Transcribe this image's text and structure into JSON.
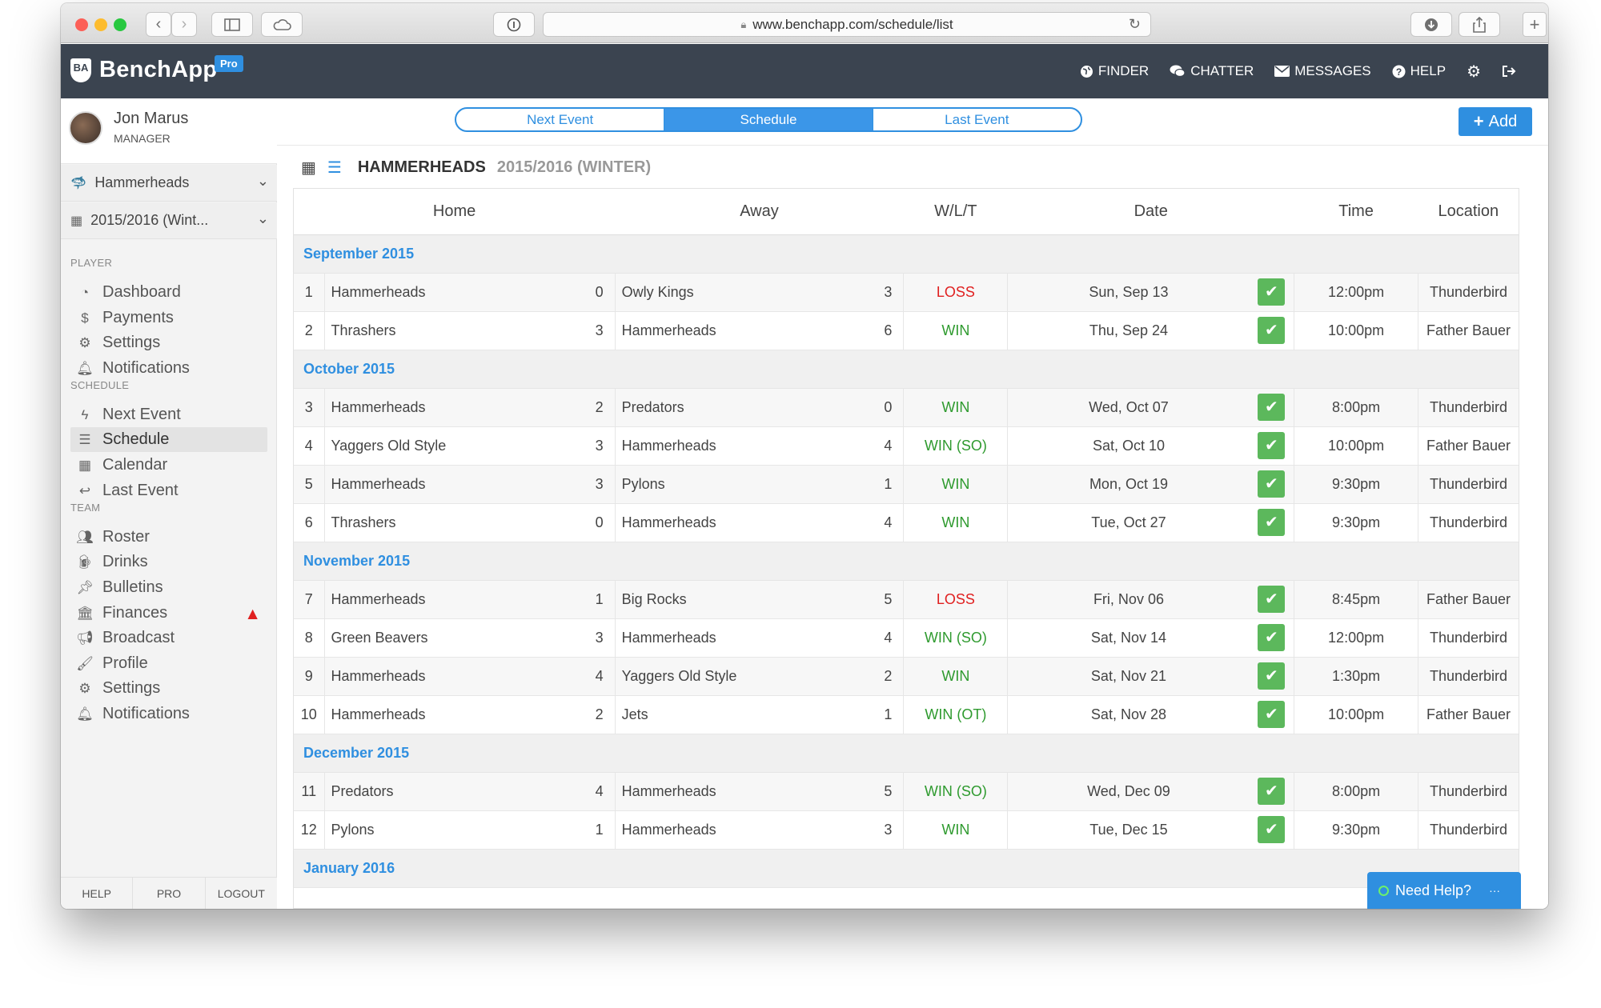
{
  "browser": {
    "url": "www.benchapp.com/schedule/list"
  },
  "app": {
    "name": "BenchApp",
    "logo_badge": "BA",
    "tier_badge": "Pro",
    "colors": {
      "accent": "#2f8fe0",
      "header": "#3b4450",
      "win": "#2e9a2e",
      "loss": "#e02020",
      "check": "#5cb85c"
    }
  },
  "topnav": {
    "finder": "FINDER",
    "chatter": "CHATTER",
    "messages": "MESSAGES",
    "help": "HELP"
  },
  "user": {
    "name": "Jon Marus",
    "role": "MANAGER"
  },
  "sidebar": {
    "team_selector": "Hammerheads",
    "season_selector": "2015/2016 (Wint...",
    "player_label": "PLAYER",
    "player_items": [
      "Dashboard",
      "Payments",
      "Settings",
      "Notifications"
    ],
    "schedule_label": "SCHEDULE",
    "schedule_items": [
      "Next Event",
      "Schedule",
      "Calendar",
      "Last Event"
    ],
    "team_label": "TEAM",
    "team_items": [
      "Roster",
      "Drinks",
      "Bulletins",
      "Finances",
      "Broadcast",
      "Profile",
      "Settings",
      "Notifications"
    ],
    "footer": [
      "HELP",
      "PRO",
      "LOGOUT"
    ]
  },
  "main": {
    "tabs": [
      "Next Event",
      "Schedule",
      "Last Event"
    ],
    "add_label": "Add",
    "title": "HAMMERHEADS",
    "subtitle": "2015/2016 (WINTER)",
    "columns": [
      "Home",
      "Away",
      "W/L/T",
      "Date",
      "Time",
      "Location"
    ],
    "months": [
      {
        "label": "September 2015",
        "games": [
          {
            "n": "1",
            "home": "Hammerheads",
            "hs": "0",
            "away": "Owly Kings",
            "as": "3",
            "res": "LOSS",
            "date": "Sun, Sep 13",
            "time": "12:00pm",
            "loc": "Thunderbird"
          },
          {
            "n": "2",
            "home": "Thrashers",
            "hs": "3",
            "away": "Hammerheads",
            "as": "6",
            "res": "WIN",
            "date": "Thu, Sep 24",
            "time": "10:00pm",
            "loc": "Father Bauer"
          }
        ]
      },
      {
        "label": "October 2015",
        "games": [
          {
            "n": "3",
            "home": "Hammerheads",
            "hs": "2",
            "away": "Predators",
            "as": "0",
            "res": "WIN",
            "date": "Wed, Oct 07",
            "time": "8:00pm",
            "loc": "Thunderbird"
          },
          {
            "n": "4",
            "home": "Yaggers Old Style",
            "hs": "3",
            "away": "Hammerheads",
            "as": "4",
            "res": "WIN (SO)",
            "date": "Sat, Oct 10",
            "time": "10:00pm",
            "loc": "Father Bauer"
          },
          {
            "n": "5",
            "home": "Hammerheads",
            "hs": "3",
            "away": "Pylons",
            "as": "1",
            "res": "WIN",
            "date": "Mon, Oct 19",
            "time": "9:30pm",
            "loc": "Thunderbird"
          },
          {
            "n": "6",
            "home": "Thrashers",
            "hs": "0",
            "away": "Hammerheads",
            "as": "4",
            "res": "WIN",
            "date": "Tue, Oct 27",
            "time": "9:30pm",
            "loc": "Thunderbird"
          }
        ]
      },
      {
        "label": "November 2015",
        "games": [
          {
            "n": "7",
            "home": "Hammerheads",
            "hs": "1",
            "away": "Big Rocks",
            "as": "5",
            "res": "LOSS",
            "date": "Fri, Nov 06",
            "time": "8:45pm",
            "loc": "Father Bauer"
          },
          {
            "n": "8",
            "home": "Green Beavers",
            "hs": "3",
            "away": "Hammerheads",
            "as": "4",
            "res": "WIN (SO)",
            "date": "Sat, Nov 14",
            "time": "12:00pm",
            "loc": "Thunderbird"
          },
          {
            "n": "9",
            "home": "Hammerheads",
            "hs": "4",
            "away": "Yaggers Old Style",
            "as": "2",
            "res": "WIN",
            "date": "Sat, Nov 21",
            "time": "1:30pm",
            "loc": "Thunderbird"
          },
          {
            "n": "10",
            "home": "Hammerheads",
            "hs": "2",
            "away": "Jets",
            "as": "1",
            "res": "WIN (OT)",
            "date": "Sat, Nov 28",
            "time": "10:00pm",
            "loc": "Father Bauer"
          }
        ]
      },
      {
        "label": "December 2015",
        "games": [
          {
            "n": "11",
            "home": "Predators",
            "hs": "4",
            "away": "Hammerheads",
            "as": "5",
            "res": "WIN (SO)",
            "date": "Wed, Dec 09",
            "time": "8:00pm",
            "loc": "Thunderbird"
          },
          {
            "n": "12",
            "home": "Pylons",
            "hs": "1",
            "away": "Hammerheads",
            "as": "3",
            "res": "WIN",
            "date": "Tue, Dec 15",
            "time": "9:30pm",
            "loc": "Thunderbird"
          }
        ]
      },
      {
        "label": "January 2016",
        "games": []
      }
    ]
  },
  "help_widget": {
    "label": "Need Help?"
  }
}
